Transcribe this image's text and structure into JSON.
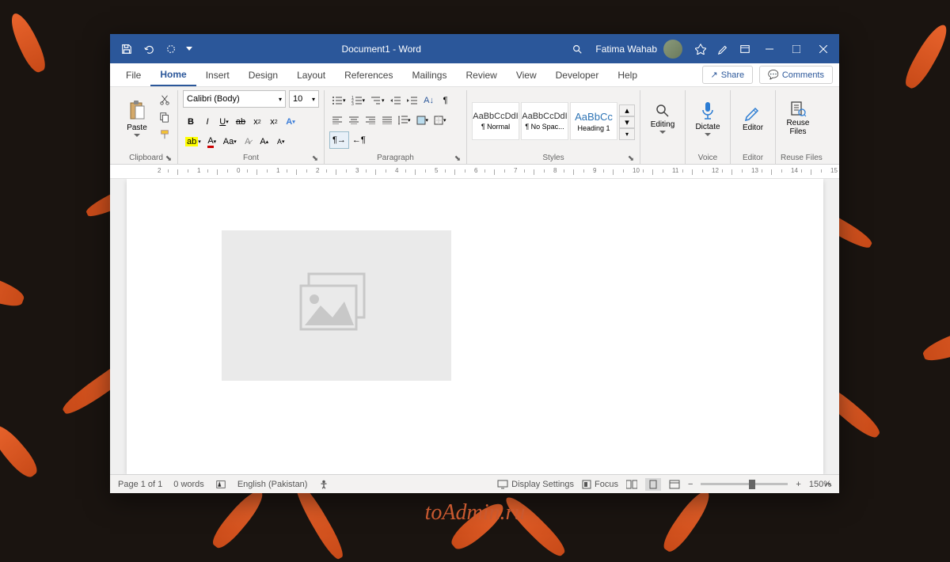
{
  "titlebar": {
    "doc_title": "Document1  -  Word",
    "user_name": "Fatima Wahab"
  },
  "menubar": {
    "tabs": [
      "File",
      "Home",
      "Insert",
      "Design",
      "Layout",
      "References",
      "Mailings",
      "Review",
      "View",
      "Developer",
      "Help"
    ],
    "active_tab": "Home",
    "share_label": "Share",
    "comments_label": "Comments"
  },
  "ribbon": {
    "clipboard": {
      "paste_label": "Paste",
      "group_label": "Clipboard"
    },
    "font": {
      "font_name": "Calibri (Body)",
      "font_size": "10",
      "group_label": "Font"
    },
    "paragraph": {
      "group_label": "Paragraph"
    },
    "styles": {
      "items": [
        {
          "preview": "AaBbCcDdI",
          "label": "¶ Normal"
        },
        {
          "preview": "AaBbCcDdI",
          "label": "¶ No Spac..."
        },
        {
          "preview": "AaBbCc",
          "label": "Heading 1"
        }
      ],
      "group_label": "Styles"
    },
    "editing": {
      "label": "Editing"
    },
    "voice": {
      "dictate_label": "Dictate",
      "group_label": "Voice"
    },
    "editor": {
      "label": "Editor",
      "group_label": "Editor"
    },
    "reuse": {
      "label": "Reuse Files",
      "group_label": "Reuse Files"
    }
  },
  "statusbar": {
    "page_info": "Page 1 of 1",
    "word_count": "0 words",
    "language": "English (Pakistan)",
    "display_settings": "Display Settings",
    "focus": "Focus",
    "zoom_pct": "150%"
  },
  "watermark": "toAdmin.ru"
}
